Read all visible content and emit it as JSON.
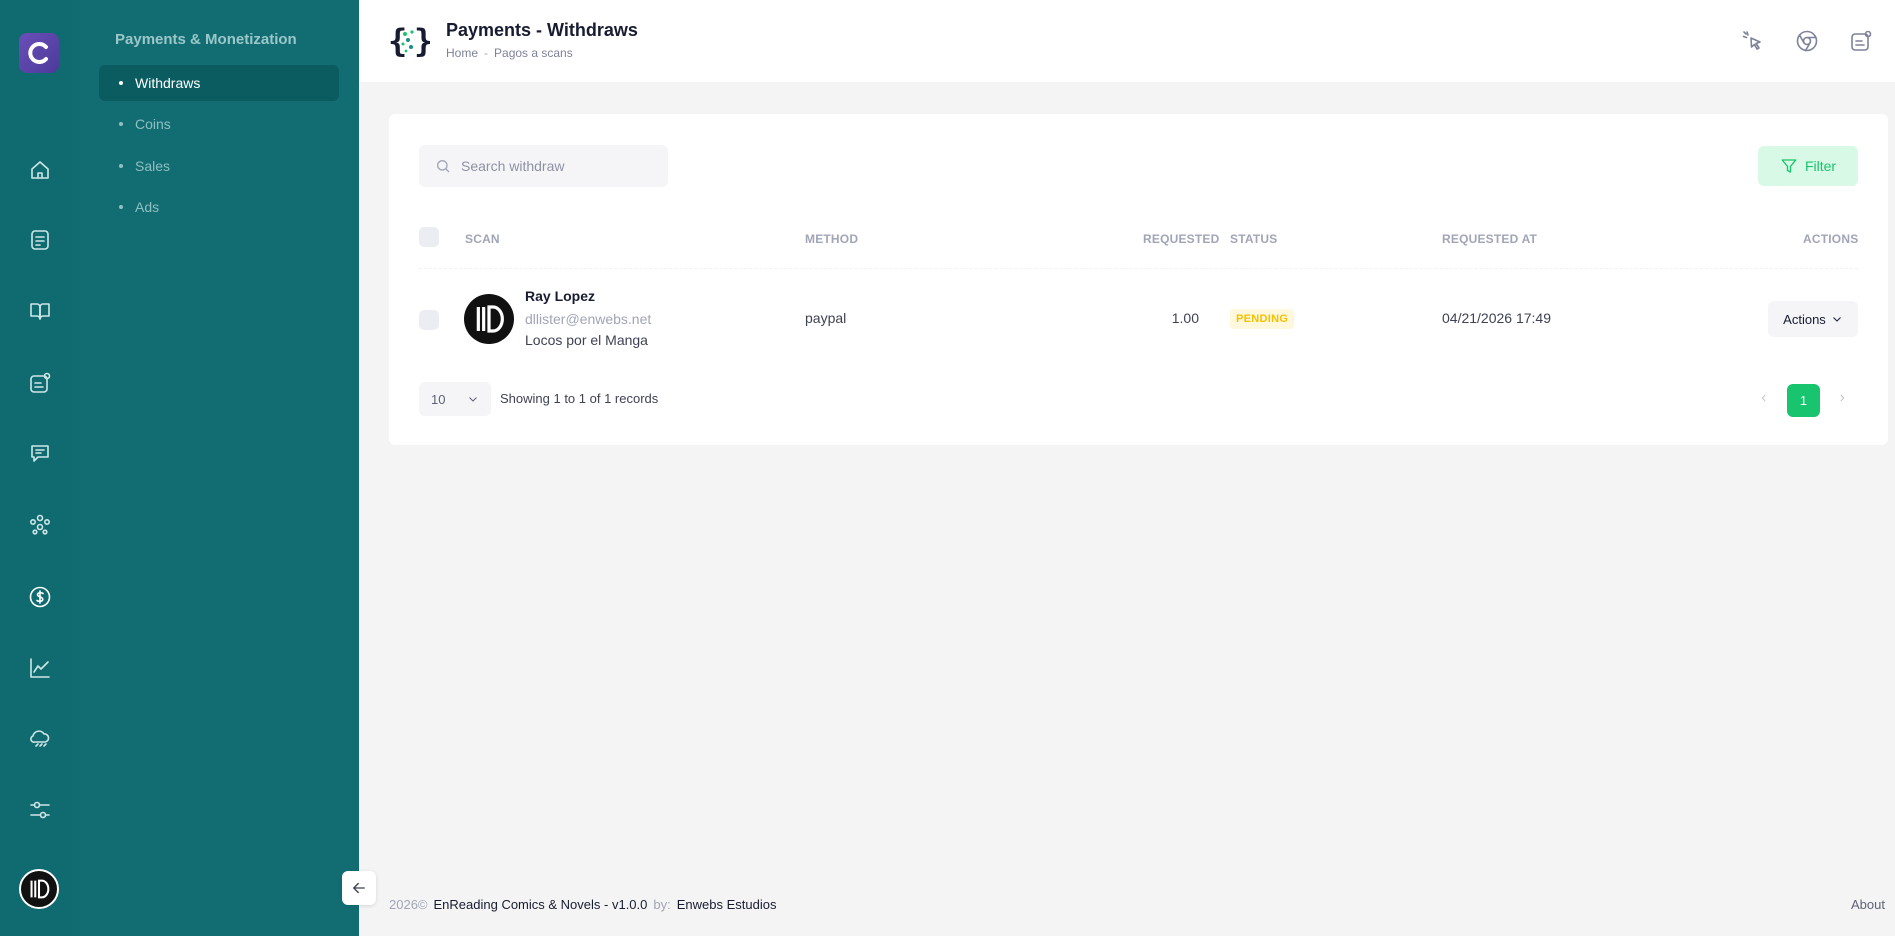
{
  "sidebar": {
    "section_title": "Payments & Monetization",
    "items": [
      {
        "label": "Withdraws",
        "active": true
      },
      {
        "label": "Coins",
        "active": false
      },
      {
        "label": "Sales",
        "active": false
      },
      {
        "label": "Ads",
        "active": false
      }
    ],
    "rail_icons": [
      "home-icon",
      "document-icon",
      "book-icon",
      "settings-card-icon",
      "chat-icon",
      "users-icon",
      "dollar-icon",
      "chart-icon",
      "cloud-rain-icon",
      "sliders-icon"
    ]
  },
  "header": {
    "title": "Payments - Withdraws",
    "breadcrumb": [
      "Home",
      "Pagos a scans"
    ],
    "breadcrumb_sep": "-"
  },
  "toolbar": {
    "search_placeholder": "Search withdraw",
    "filter_label": "Filter"
  },
  "table": {
    "columns": [
      "Scan",
      "Method",
      "Requested",
      "Status",
      "Requested At",
      "Actions"
    ],
    "rows": [
      {
        "name": "Ray Lopez",
        "email": "dllister@enwebs.net",
        "scan": "Locos por el Manga",
        "method": "paypal",
        "requested": "1.00",
        "status": "PENDING",
        "requested_at": "04/21/2026 17:49",
        "actions_label": "Actions"
      }
    ]
  },
  "pagination": {
    "page_size": "10",
    "records_text": "Showing 1 to 1 of 1 records",
    "current_page": "1"
  },
  "footer": {
    "year": "2026©",
    "app": "EnReading Comics & Novels - v1.0.0",
    "by": "by:",
    "company": "Enwebs Estudios",
    "about": "About"
  },
  "colors": {
    "rail": "#106b70",
    "subnav": "#126d73",
    "accent_green": "#19c46e",
    "pending_badge": "#f6c000"
  }
}
